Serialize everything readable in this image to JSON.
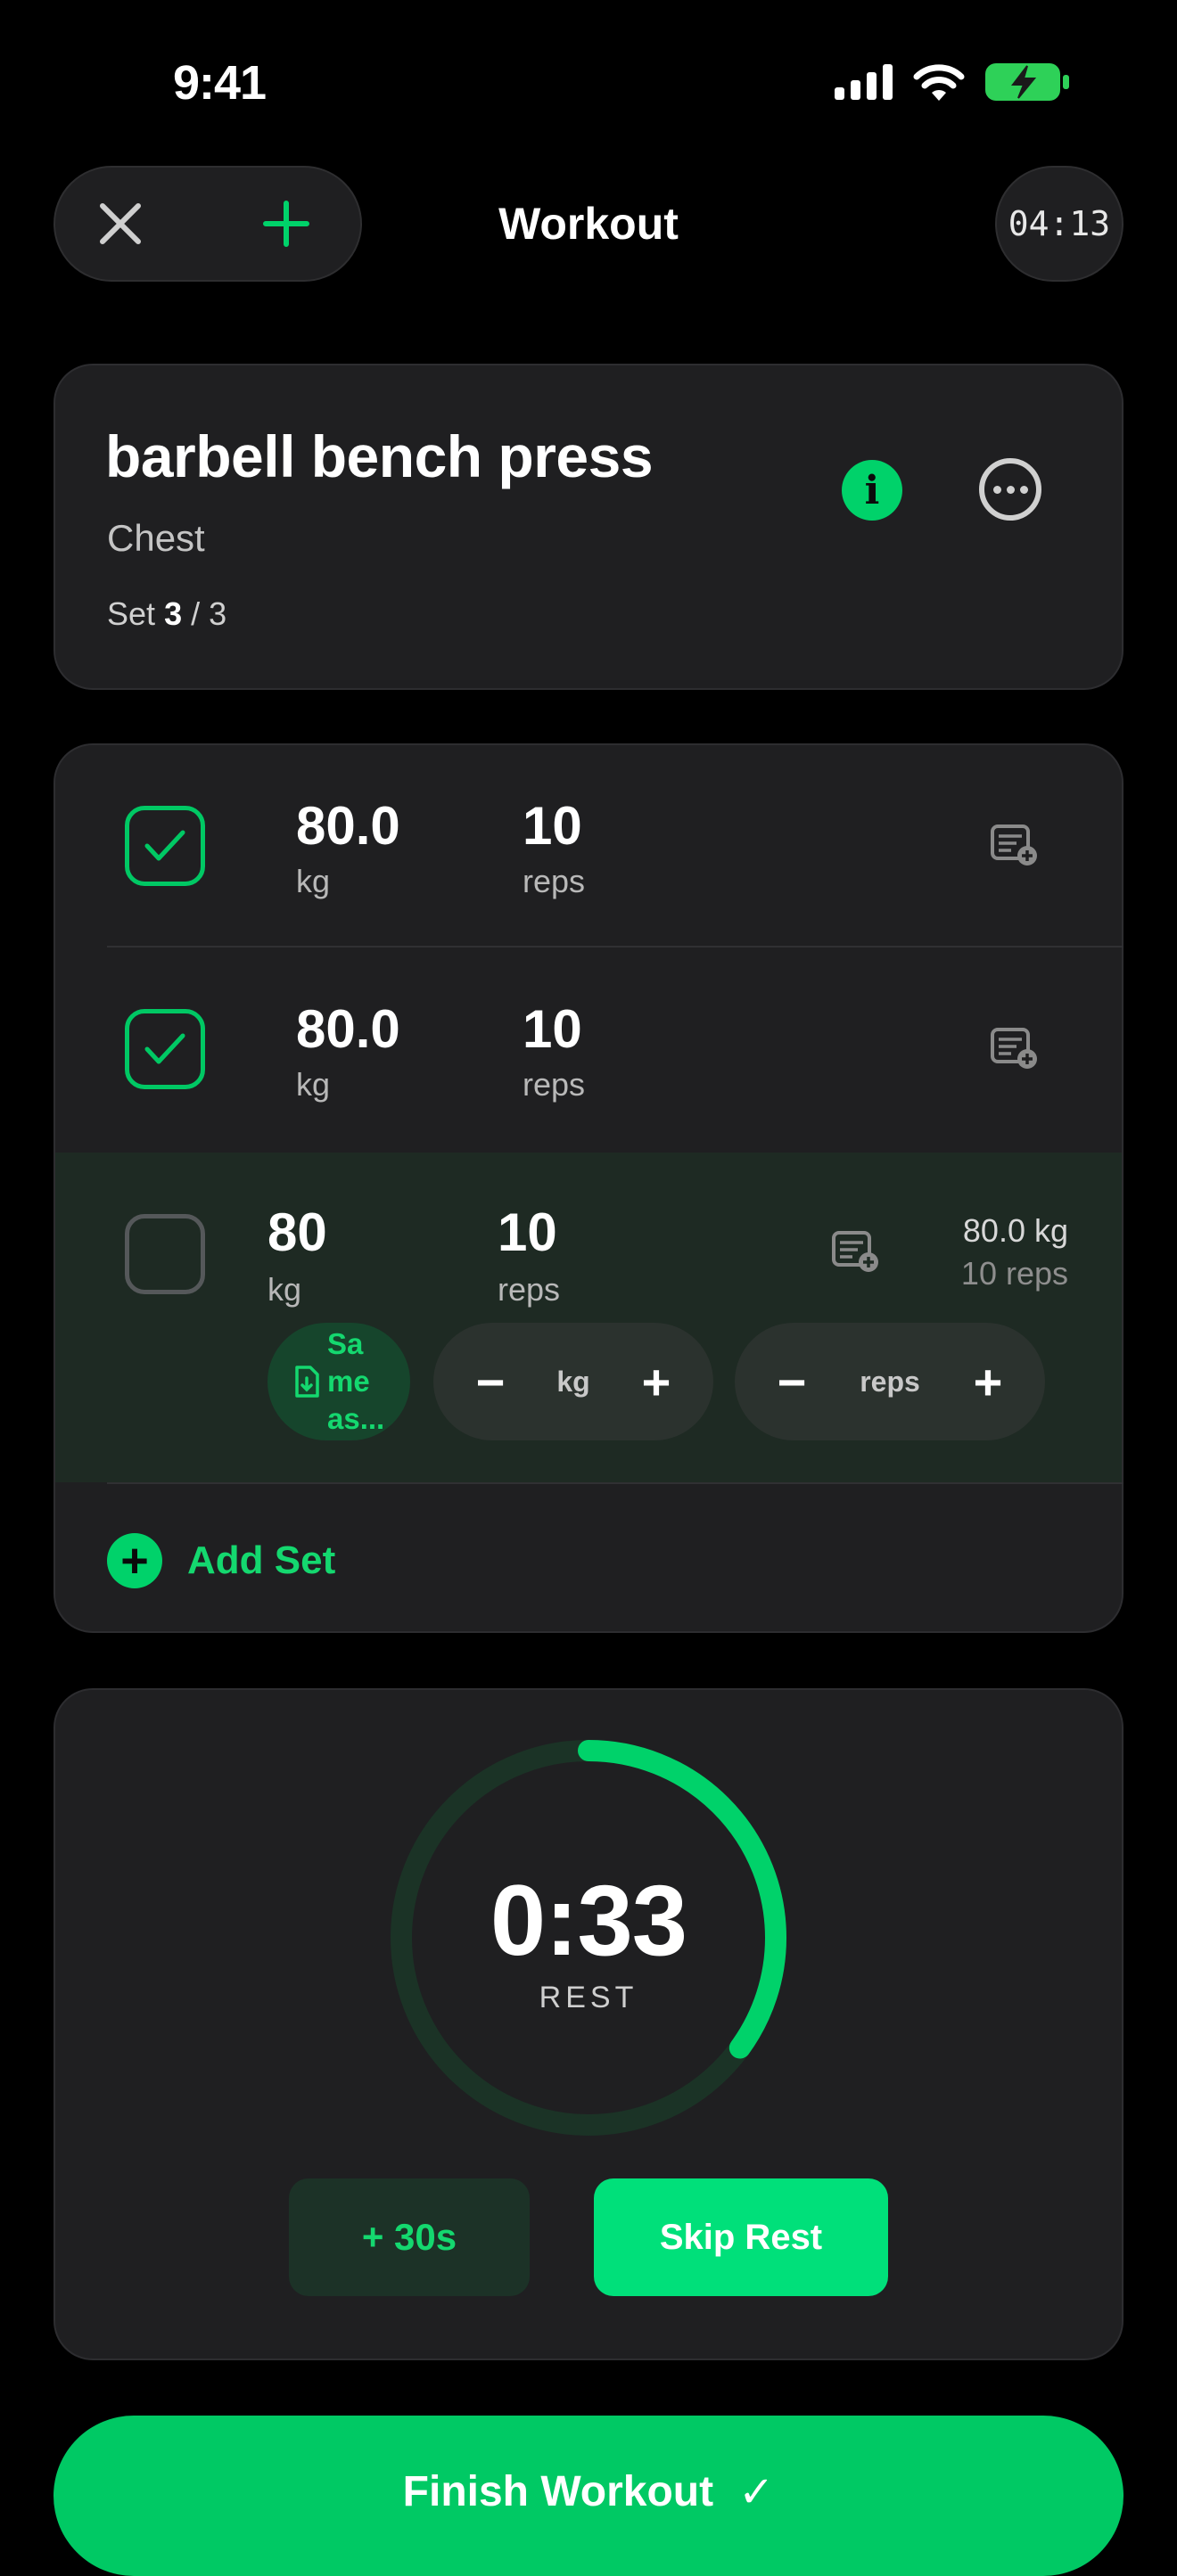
{
  "status_bar": {
    "time": "9:41"
  },
  "nav": {
    "title": "Workout",
    "elapsed": "04:13"
  },
  "exercise": {
    "name": "barbell bench press",
    "muscle": "Chest",
    "set_prefix": "Set",
    "set_current": "3",
    "set_total": "/ 3"
  },
  "sets": [
    {
      "weight": "80.0",
      "weight_unit": "kg",
      "reps": "10",
      "reps_unit": "reps",
      "completed": true
    },
    {
      "weight": "80.0",
      "weight_unit": "kg",
      "reps": "10",
      "reps_unit": "reps",
      "completed": true
    },
    {
      "weight": "80",
      "weight_unit": "kg",
      "reps": "10",
      "reps_unit": "reps",
      "completed": false,
      "previous_weight": "80.0 kg",
      "previous_reps": "10 reps"
    }
  ],
  "active_controls": {
    "same_as_label": "Sa me as...",
    "same_as_lines": [
      "Sa",
      "me",
      "as..."
    ],
    "kg_label": "kg",
    "reps_label": "reps",
    "minus": "−",
    "plus": "+"
  },
  "add_set_label": "Add Set",
  "rest": {
    "time": "0:33",
    "label": "REST",
    "progress_fraction": 0.35,
    "add_label": "+ 30s",
    "skip_label": "Skip Rest"
  },
  "finish": {
    "label": "Finish Workout",
    "check": "✓"
  },
  "colors": {
    "accent": "#00d26a",
    "background": "#000000",
    "card": "#1f1f21"
  }
}
